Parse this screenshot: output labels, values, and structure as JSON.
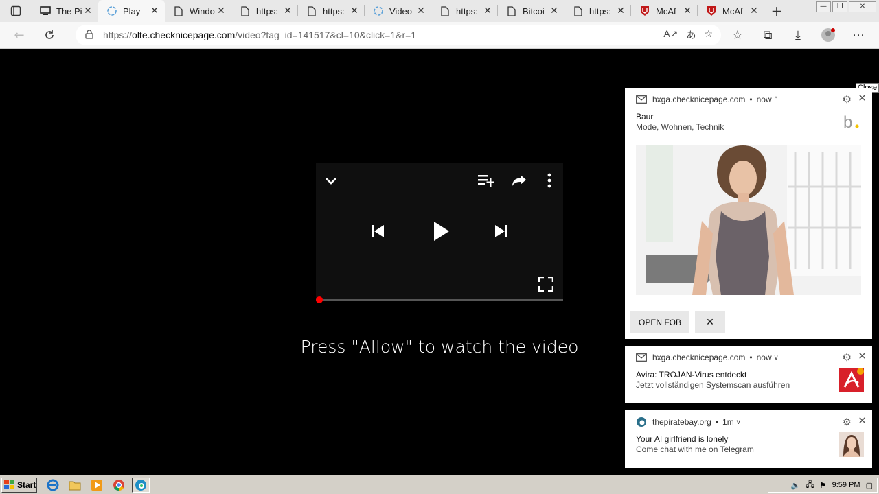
{
  "browser": {
    "tabs": [
      {
        "title": "The Pi",
        "icon": "app-icon",
        "active": false
      },
      {
        "title": "Play",
        "icon": "edge-spinner-icon",
        "active": true
      },
      {
        "title": "Windo",
        "icon": "page-icon",
        "active": false
      },
      {
        "title": "https:",
        "icon": "page-icon",
        "active": false
      },
      {
        "title": "https:",
        "icon": "page-icon",
        "active": false
      },
      {
        "title": "Video",
        "icon": "edge-spinner-icon",
        "active": false
      },
      {
        "title": "https:",
        "icon": "page-icon",
        "active": false
      },
      {
        "title": "Bitcoi",
        "icon": "page-icon",
        "active": false
      },
      {
        "title": "https:",
        "icon": "page-icon",
        "active": false
      },
      {
        "title": "McAf",
        "icon": "mcafee-icon",
        "active": false
      },
      {
        "title": "McAf",
        "icon": "mcafee-icon",
        "active": false
      }
    ],
    "url": {
      "scheme": "https://",
      "domain": "olte.checknicepage.com",
      "path": "/video?tag_id=141517&cl=10&click=1&r=1"
    }
  },
  "page": {
    "prompt": "Press \"Allow\" to watch the video"
  },
  "notifications": {
    "close_tooltip": "Close",
    "items": [
      {
        "source": "hxga.checknicepage.com",
        "time": "now",
        "caret": "^",
        "title": "Baur",
        "body": "Mode, Wohnen, Technik",
        "primary_button": "OPEN FOB",
        "dismiss_button": "✕"
      },
      {
        "source": "hxga.checknicepage.com",
        "time": "now",
        "caret": "v",
        "title": "Avira: TROJAN-Virus entdeckt",
        "body": "Jetzt vollständigen Systemscan ausführen"
      },
      {
        "source": "thepiratebay.org",
        "time": "1m",
        "caret": "v",
        "title": "Your AI girlfriend is lonely",
        "body": "Come chat with me on Telegram"
      }
    ]
  },
  "taskbar": {
    "start_label": "Start",
    "clock": "9:59 PM"
  },
  "colors": {
    "progress_dot": "#ff0000",
    "avira_red": "#d8202a",
    "mcafee_red": "#c01818"
  }
}
